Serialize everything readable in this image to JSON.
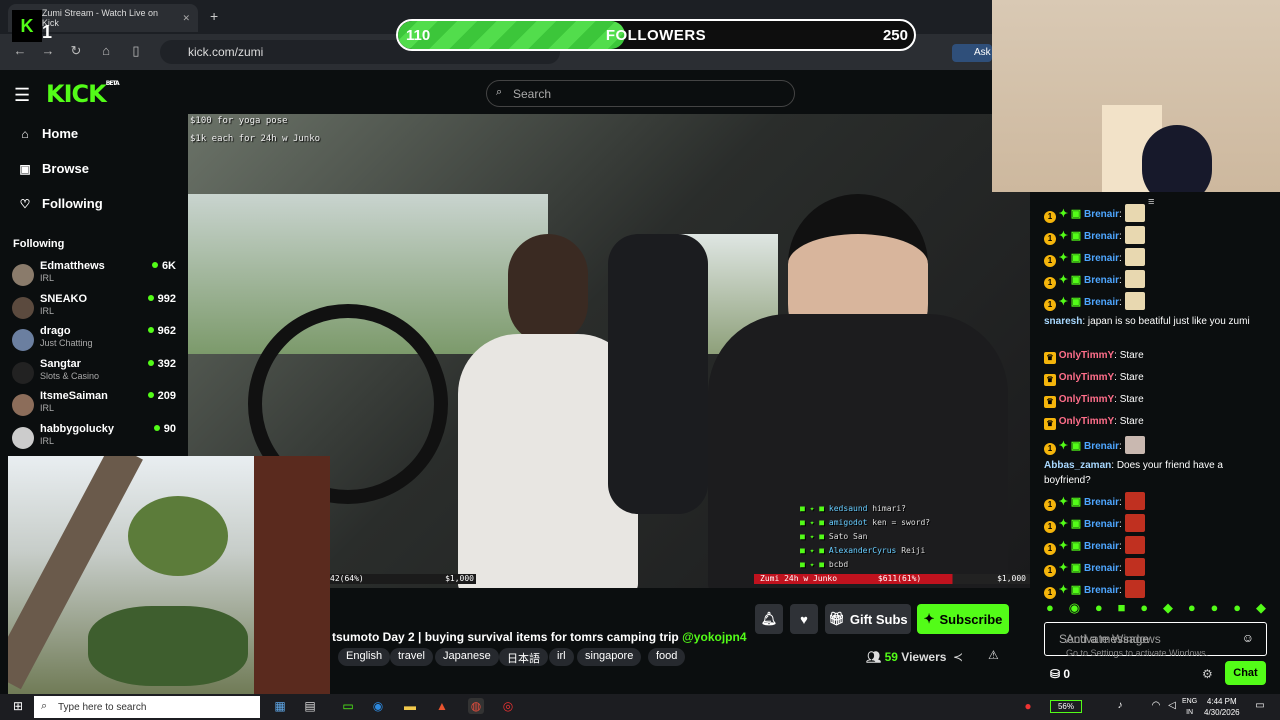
{
  "browser": {
    "tab_title": "Zumi Stream - Watch Live on Kick",
    "url": "kick.com/zumi",
    "new_tab": "+",
    "close_tab": "✕",
    "ask": "Ask"
  },
  "overlay_badge": {
    "letter": "K",
    "number": "1"
  },
  "followers": {
    "current": "110",
    "label": "FOLLOWERS",
    "goal": "250",
    "progress": 0.44
  },
  "header": {
    "logo": "KICK",
    "logo_sup": "BETA",
    "search_placeholder": "Search"
  },
  "sidebar": {
    "nav": [
      {
        "label": "Home",
        "icon": "home-icon"
      },
      {
        "label": "Browse",
        "icon": "browse-icon"
      },
      {
        "label": "Following",
        "icon": "heart-icon"
      }
    ],
    "following_heading": "Following",
    "following": [
      {
        "name": "Edmatthews",
        "category": "IRL",
        "viewers": "6K",
        "color": "#8a7b6b"
      },
      {
        "name": "SNEAKO",
        "category": "IRL",
        "viewers": "992",
        "color": "#5b4a3e"
      },
      {
        "name": "drago",
        "category": "Just Chatting",
        "viewers": "962",
        "color": "#6b7fa0"
      },
      {
        "name": "Sangtar",
        "category": "Slots & Casino",
        "viewers": "392",
        "color": "#222"
      },
      {
        "name": "ItsmeSaiman",
        "category": "IRL",
        "viewers": "209",
        "color": "#8c6d5a"
      },
      {
        "name": "habbygolucky",
        "category": "IRL",
        "viewers": "90",
        "color": "#ccc"
      }
    ]
  },
  "video": {
    "overlay_lines": [
      "$100 for yoga pose",
      "$1k each for 24h w Junko"
    ],
    "goal_left_pct": "42(64%)",
    "goal_left_amount": "$1,000",
    "goal_right_label": "Zumi 24h w Junko",
    "goal_right_pct": "$611(61%)",
    "goal_right_amount": "$1,000",
    "chat_overlay": [
      {
        "user": "kedsaund",
        "text": "himari?"
      },
      {
        "user": "amigodot",
        "text": "ken = sword?"
      },
      {
        "user": "",
        "text": "Sato San"
      },
      {
        "user": "AlexanderCyrus",
        "text": "Reiji"
      },
      {
        "user": "",
        "text": "bcbd"
      }
    ]
  },
  "stream": {
    "title": "tsumoto Day 2 | buying survival items for tomrs camping trip",
    "mention": "@yokojpn4",
    "tags": [
      "Japanese",
      "English",
      "travel",
      "Japanese",
      "日本語",
      "irl",
      "singapore",
      "food"
    ],
    "viewers_count": "59",
    "viewers_label": "Viewers",
    "gift_subs": "Gift Subs",
    "subscribe": "Subscribe"
  },
  "chat": {
    "messages": [
      {
        "user": "Brenair",
        "type": "emote",
        "color": "blue",
        "emote": "#e8d8b0"
      },
      {
        "user": "Brenair",
        "type": "emote",
        "color": "blue",
        "emote": "#e8d8b0"
      },
      {
        "user": "Brenair",
        "type": "emote",
        "color": "blue",
        "emote": "#e8d8b0"
      },
      {
        "user": "Brenair",
        "type": "emote",
        "color": "blue",
        "emote": "#e8d8b0"
      },
      {
        "user": "Brenair",
        "type": "emote",
        "color": "blue",
        "emote": "#e8d8b0"
      },
      {
        "user": "snaresh",
        "type": "text",
        "color": "cyan",
        "text": "japan is so beatiful just like you zumi"
      },
      {
        "user": "OnlyTimmY",
        "type": "text",
        "color": "pink",
        "text": "Stare"
      },
      {
        "user": "OnlyTimmY",
        "type": "text",
        "color": "pink",
        "text": "Stare"
      },
      {
        "user": "OnlyTimmY",
        "type": "text",
        "color": "pink",
        "text": "Stare"
      },
      {
        "user": "OnlyTimmY",
        "type": "text",
        "color": "pink",
        "text": "Stare"
      },
      {
        "user": "Brenair",
        "type": "emote",
        "color": "blue",
        "emote": "#c9b8b0"
      },
      {
        "user": "Abbas_zaman",
        "type": "text",
        "color": "cyan",
        "text": "Does your friend have a boyfriend?"
      },
      {
        "user": "Brenair",
        "type": "emote",
        "color": "blue",
        "emote": "#c03020"
      },
      {
        "user": "Brenair",
        "type": "emote",
        "color": "blue",
        "emote": "#c03020"
      },
      {
        "user": "Brenair",
        "type": "emote",
        "color": "blue",
        "emote": "#c03020"
      },
      {
        "user": "Brenair",
        "type": "emote",
        "color": "blue",
        "emote": "#c03020"
      },
      {
        "user": "Brenair",
        "type": "emote",
        "color": "blue",
        "emote": "#c03020"
      }
    ],
    "input_placeholder": "Send a message",
    "activate_windows": "Activate Windows",
    "activate_windows_sub": "Go to Settings to activate Windows.",
    "chat_button": "Chat",
    "points": "0"
  },
  "taskbar": {
    "search_placeholder": "Type here to search",
    "battery": "56%",
    "lang_line1": "ENG",
    "lang_line2": "IN",
    "time": "4:44 PM",
    "date": "4/30/2026"
  },
  "colors": {
    "accent": "#53fc18",
    "background": "#0b0e0f"
  }
}
